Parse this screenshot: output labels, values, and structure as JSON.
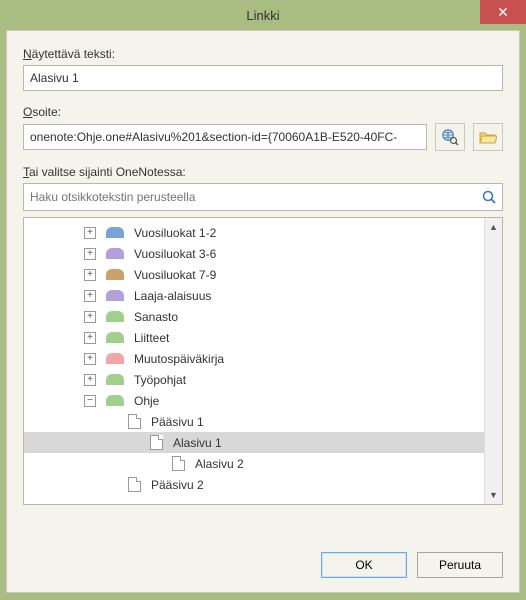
{
  "window": {
    "title": "Linkki",
    "close_glyph": "✕"
  },
  "labels": {
    "display_text": "Näytettävä teksti:",
    "address": "Osoite:",
    "or_pick": "Tai valitse sijainti OneNotessa:"
  },
  "fields": {
    "display_text_value": "Alasivu 1",
    "address_value": "onenote:Ohje.one#Alasivu%201&section-id={70060A1B-E520-40FC-",
    "search_placeholder": "Haku otsikkotekstin perusteella"
  },
  "tree": [
    {
      "exp": "+",
      "kind": "section",
      "color": "#7aa3d6",
      "label": "Vuosiluokat 1-2",
      "indent": 0
    },
    {
      "exp": "+",
      "kind": "section",
      "color": "#b1a0d9",
      "label": "Vuosiluokat 3-6",
      "indent": 0
    },
    {
      "exp": "+",
      "kind": "section",
      "color": "#caa06b",
      "label": "Vuosiluokat 7-9",
      "indent": 0
    },
    {
      "exp": "+",
      "kind": "section",
      "color": "#b1a0d9",
      "label": "Laaja-alaisuus",
      "indent": 0
    },
    {
      "exp": "+",
      "kind": "section",
      "color": "#9fd08c",
      "label": "Sanasto",
      "indent": 0
    },
    {
      "exp": "+",
      "kind": "section",
      "color": "#9fd08c",
      "label": "Liitteet",
      "indent": 0
    },
    {
      "exp": "+",
      "kind": "section",
      "color": "#eea6a6",
      "label": "Muutospäiväkirja",
      "indent": 0
    },
    {
      "exp": "+",
      "kind": "section",
      "color": "#9fd08c",
      "label": "Työpohjat",
      "indent": 0
    },
    {
      "exp": "-",
      "kind": "section",
      "color": "#9fd08c",
      "label": "Ohje",
      "indent": 0
    },
    {
      "exp": "",
      "kind": "page",
      "color": "",
      "label": "Pääsivu 1",
      "indent": 1
    },
    {
      "exp": "",
      "kind": "page",
      "color": "",
      "label": "Alasivu 1",
      "indent": 2,
      "selected": true
    },
    {
      "exp": "",
      "kind": "page",
      "color": "",
      "label": "Alasivu 2",
      "indent": 3
    },
    {
      "exp": "",
      "kind": "page",
      "color": "",
      "label": "Pääsivu 2",
      "indent": 1
    }
  ],
  "buttons": {
    "ok": "OK",
    "cancel": "Peruuta"
  }
}
